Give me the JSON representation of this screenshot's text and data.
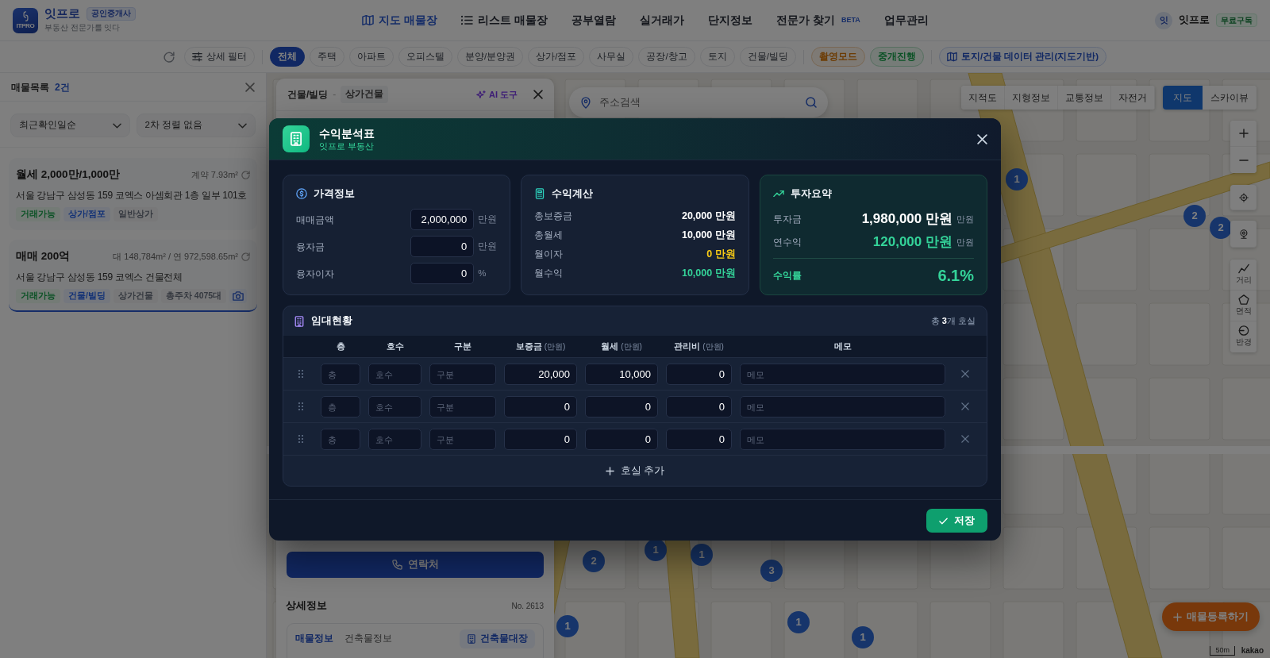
{
  "header": {
    "logo_text": "ITPRO",
    "brand": "잇프로",
    "brand_badge": "공인중개사",
    "tagline": "부동산 전문가를 잇다",
    "nav": [
      {
        "label": "지도 매물장",
        "selected": true
      },
      {
        "label": "리스트 매물장",
        "selected": false
      },
      {
        "label": "공부열람",
        "selected": false
      },
      {
        "label": "실거래가",
        "selected": false
      },
      {
        "label": "단지정보",
        "selected": false
      },
      {
        "label": "전문가 찾기",
        "badge": "BETA",
        "selected": false
      },
      {
        "label": "업무관리",
        "selected": false
      }
    ],
    "user": {
      "avatar": "잇",
      "name": "잇프로",
      "plan": "무료구독"
    }
  },
  "filter_bar": {
    "detail_filter": "상세 필터",
    "categories": [
      {
        "label": "전체",
        "selected": true
      },
      {
        "label": "주택",
        "selected": false
      },
      {
        "label": "아파트",
        "selected": false
      },
      {
        "label": "오피스텔",
        "selected": false
      },
      {
        "label": "분양/분양권",
        "selected": false
      },
      {
        "label": "상가/점포",
        "selected": false
      },
      {
        "label": "사무실",
        "selected": false
      },
      {
        "label": "공장/창고",
        "selected": false
      },
      {
        "label": "토지",
        "selected": false
      },
      {
        "label": "건물/빌딩",
        "selected": false
      }
    ],
    "modes": [
      {
        "label": "촬영모드",
        "kind": "photo"
      },
      {
        "label": "중개진행",
        "kind": "brokerage"
      }
    ],
    "data_button": "토지/건물 데이터 관리(지도기반)"
  },
  "listing_panel": {
    "title": "매물목록",
    "count": "2건",
    "sorts": [
      {
        "value": "최근확인일순"
      },
      {
        "value": "2차 정렬 없음"
      }
    ],
    "listings": [
      {
        "title": "월세 2,000만/1,000만",
        "area": "계약 7.93m²",
        "address": "서울 강남구 삼성동 159 코엑스 아셈회관 1층 일부 101호",
        "tags": [
          {
            "label": "거래가능",
            "kind": "status"
          },
          {
            "label": "상가/점포",
            "kind": "category"
          },
          {
            "label": "일반상가",
            "kind": "detail"
          }
        ],
        "has_photos": false,
        "selected": false
      },
      {
        "title": "매매 200억",
        "area": "대 148,784m² / 연 972,598.65m²",
        "address": "서울 강남구 삼성동 159 코엑스 건물전체",
        "tags": [
          {
            "label": "거래가능",
            "kind": "status"
          },
          {
            "label": "건물/빌딩",
            "kind": "category"
          },
          {
            "label": "상가건물",
            "kind": "detail"
          },
          {
            "label": "총주차 4075대",
            "kind": "detail"
          }
        ],
        "has_photos": true,
        "selected": true
      }
    ]
  },
  "map": {
    "search": {
      "placeholder": "주소검색"
    },
    "layers": [
      {
        "label": "지적도"
      },
      {
        "label": "지형정보"
      },
      {
        "label": "교통정보"
      },
      {
        "label": "자전거"
      }
    ],
    "map_types": [
      {
        "label": "지도",
        "selected": true
      },
      {
        "label": "스카이뷰",
        "selected": false
      }
    ],
    "tools": [
      {
        "label": "거리"
      },
      {
        "label": "면적"
      },
      {
        "label": "반경"
      }
    ],
    "markers": [
      {
        "count": "1"
      },
      {
        "count": "2"
      },
      {
        "count": "2"
      },
      {
        "count": "1"
      },
      {
        "count": "2"
      },
      {
        "count": "1"
      },
      {
        "count": "3"
      },
      {
        "count": "1"
      },
      {
        "count": "1"
      },
      {
        "count": "1"
      }
    ],
    "scale": "50m",
    "attribution": "kakao",
    "register_button": "매물등록하기"
  },
  "detail_panel": {
    "category": "건물/빌딩",
    "separator": "-",
    "subcategory": "상가건물",
    "ai_tool": "AI 도구",
    "contact_button": "연락처",
    "section_title": "상세정보",
    "number": "No. 2613",
    "tabs": [
      {
        "label": "매물정보",
        "selected": true
      },
      {
        "label": "건축물정보",
        "selected": false
      }
    ],
    "register_button": "건축물대장"
  },
  "modal": {
    "title": "수익분석표",
    "subtitle": "잇프로 부동산",
    "price_info": {
      "title": "가격정보",
      "fields": [
        {
          "label": "매매금액",
          "value": "2,000,000",
          "unit": "만원"
        },
        {
          "label": "융자금",
          "value": "0",
          "unit": "만원"
        },
        {
          "label": "융자이자",
          "value": "0",
          "unit": "%"
        }
      ]
    },
    "calculation": {
      "title": "수익계산",
      "rows": [
        {
          "label": "총보증금",
          "value": "20,000 만원",
          "color": "#ffffff"
        },
        {
          "label": "총월세",
          "value": "10,000 만원",
          "color": "#ffffff"
        },
        {
          "label": "월이자",
          "value": "0 만원",
          "color": "#facc15"
        },
        {
          "label": "월수익",
          "value": "10,000 만원",
          "color": "#34d399"
        }
      ]
    },
    "summary": {
      "title": "투자요약",
      "rows": [
        {
          "label": "투자금",
          "value": "1,980,000 만원",
          "unit": "만원",
          "color": "#ffffff"
        },
        {
          "label": "연수익",
          "value": "120,000 만원",
          "unit": "만원",
          "color": "#34d399"
        }
      ],
      "yield": {
        "label": "수익률",
        "value": "6.1%"
      }
    },
    "rentals": {
      "title": "임대현황",
      "total": "총 **3**개 호실",
      "columns": [
        {
          "label": "층",
          "kind": "text"
        },
        {
          "label": "호수",
          "kind": "text"
        },
        {
          "label": "구분",
          "kind": "text"
        },
        {
          "label": "보증금",
          "unit": "(만원)",
          "kind": "number"
        },
        {
          "label": "월세",
          "unit": "(만원)",
          "kind": "number"
        },
        {
          "label": "관리비",
          "unit": "(만원)",
          "kind": "number"
        },
        {
          "label": "메모",
          "kind": "text"
        }
      ],
      "rows": [
        {
          "cells": [
            {
              "placeholder": "층"
            },
            {
              "placeholder": "호수"
            },
            {
              "placeholder": "구분"
            },
            {
              "value": "20,000"
            },
            {
              "value": "10,000"
            },
            {
              "value": "0"
            },
            {
              "placeholder": "메모"
            }
          ]
        },
        {
          "cells": [
            {
              "placeholder": "층"
            },
            {
              "placeholder": "호수"
            },
            {
              "placeholder": "구분"
            },
            {
              "value": "0"
            },
            {
              "value": "0"
            },
            {
              "value": "0"
            },
            {
              "placeholder": "메모"
            }
          ]
        },
        {
          "cells": [
            {
              "placeholder": "층"
            },
            {
              "placeholder": "호수"
            },
            {
              "placeholder": "구분"
            },
            {
              "value": "0"
            },
            {
              "value": "0"
            },
            {
              "value": "0"
            },
            {
              "placeholder": "메모"
            }
          ]
        }
      ],
      "add_button": "호실 추가"
    },
    "save_button": "저장"
  }
}
